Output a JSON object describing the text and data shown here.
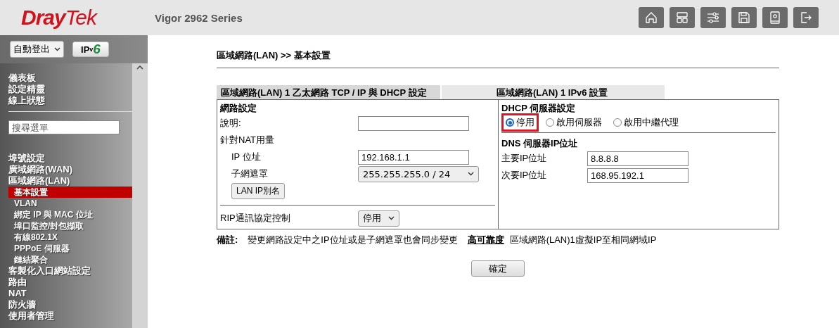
{
  "header": {
    "logo": {
      "main": "Dray",
      "accent": "Tek"
    },
    "model": "Vigor 2962 Series",
    "toolbar": [
      {
        "kind": "home"
      },
      {
        "kind": "layout"
      },
      {
        "kind": "sliders"
      },
      {
        "kind": "save"
      },
      {
        "kind": "book"
      },
      {
        "kind": "logout"
      }
    ]
  },
  "sidebar": {
    "logout_select": "自動登出",
    "ipv6_logo": {
      "main": "IP",
      "sub": "v",
      "num": "6"
    },
    "top_items": [
      {
        "label": "儀表板",
        "selected": false
      },
      {
        "label": "設定精靈",
        "selected": false
      },
      {
        "label": "線上狀態",
        "selected": false
      }
    ],
    "search": {
      "placeholder": "搜尋選單"
    },
    "items": [
      {
        "label": "埠號設定",
        "selected": false
      },
      {
        "label": "廣域網路(WAN)",
        "selected": false
      },
      {
        "label": "區域網路(LAN)",
        "selected": false,
        "children": [
          {
            "label": "基本設置",
            "selected": true
          },
          {
            "label": "VLAN",
            "selected": false
          },
          {
            "label": "綁定 IP 與 MAC 位址",
            "selected": false
          },
          {
            "label": "埠口監控/封包擷取",
            "selected": false
          },
          {
            "label": "有線802.1X",
            "selected": false
          },
          {
            "label": "PPPoE 伺服器",
            "selected": false
          },
          {
            "label": "鏈結聚合",
            "selected": false
          }
        ]
      },
      {
        "label": "客製化入口網站設定",
        "selected": false
      },
      {
        "label": "路由",
        "selected": false
      },
      {
        "label": "NAT",
        "selected": false
      },
      {
        "label": "防火牆",
        "selected": false
      },
      {
        "label": "使用者管理",
        "selected": false
      }
    ]
  },
  "content": {
    "breadcrumb": "區域網路(LAN) >> 基本設置",
    "tabs": [
      {
        "label": "區域網路(LAN) 1 乙太網路 TCP / IP 與 DHCP 設定",
        "selected": true
      },
      {
        "label": "區域網路(LAN) 1 IPv6 設置",
        "selected": false
      }
    ],
    "left": {
      "title": "網路設定",
      "fields": [
        {
          "kind": "input",
          "label": "說明:"
        },
        {
          "kind": "heading",
          "label": "針對NAT用量"
        },
        {
          "kind": "input",
          "label": "IP 位址",
          "value": "192.168.1.1",
          "indent": true
        },
        {
          "kind": "select",
          "label": "子網遮罩",
          "value": "255.255.255.0 / 24",
          "indent": true
        },
        {
          "kind": "button",
          "label": "LAN IP別名"
        }
      ],
      "rip": {
        "label": "RIP通訊協定控制",
        "value": "停用"
      }
    },
    "right": {
      "title": "DHCP 伺服器設定",
      "radios": [
        {
          "label": "停用",
          "selected": true,
          "highlighted": true
        },
        {
          "label": "啟用伺服器",
          "selected": false,
          "highlighted": false
        },
        {
          "label": "啟用中繼代理",
          "selected": false,
          "highlighted": false
        }
      ],
      "dns_title": "DNS 伺服器IP位址",
      "dns": [
        {
          "label": "主要IP位址",
          "value": "8.8.8.8"
        },
        {
          "label": "次要IP位址",
          "value": "168.95.192.1"
        }
      ]
    },
    "note": {
      "label": "備註:",
      "text": "變更網路設定中之IP位址或是子網遮罩也會同步變更",
      "link": "高可靠度",
      "rest": "區域網路(LAN)1虛擬IP至相同網域IP"
    },
    "ok_button": "確定"
  }
}
